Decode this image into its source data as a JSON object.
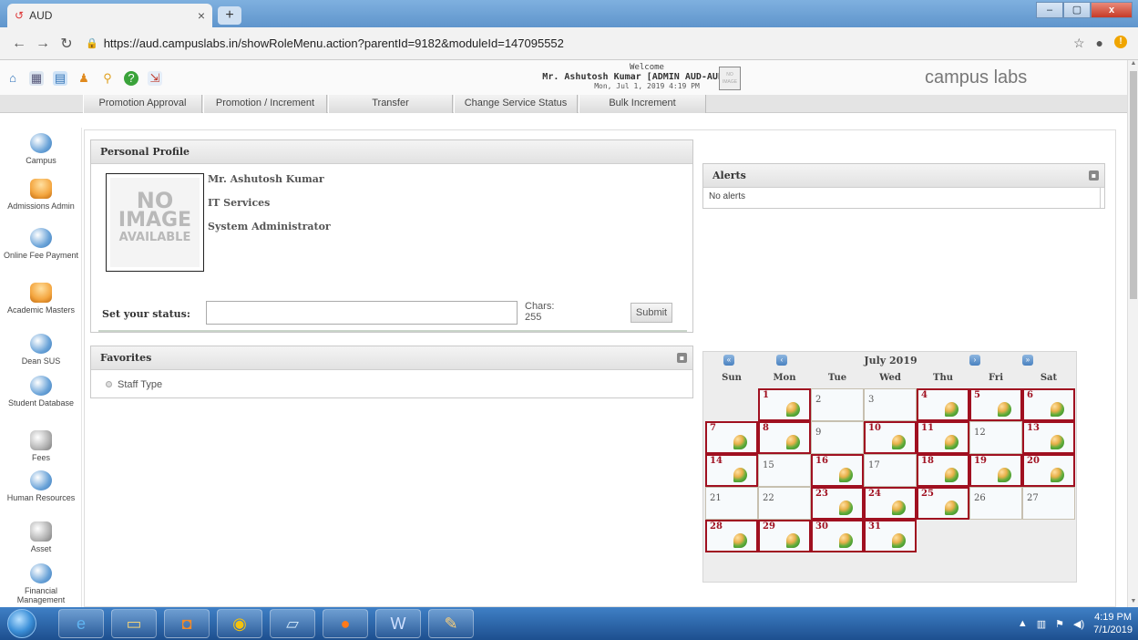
{
  "browser": {
    "tab_title": "AUD",
    "tab_close": "×",
    "new_tab": "+",
    "url": "https://aud.campuslabs.in/showRoleMenu.action?parentId=9182&moduleId=147095552",
    "window_buttons": {
      "minimize": "–",
      "maximize": "▢",
      "close": "x"
    }
  },
  "header": {
    "welcome": "Welcome",
    "user": "Mr. Ashutosh Kumar [ADMIN AUD-AUD]",
    "datetime": "Mon, Jul 1, 2019 4:19 PM",
    "brand": "campus labs",
    "toolbar_icons": [
      "home-icon",
      "calendar-icon",
      "user-docs-icon",
      "users-icon",
      "search-users-icon",
      "help-icon",
      "logout-icon"
    ]
  },
  "menu": {
    "items": [
      "Promotion Approval",
      "Promotion / Increment",
      "Transfer",
      "Change Service Status",
      "Bulk Increment"
    ]
  },
  "sidebar": {
    "items": [
      {
        "label": "Campus",
        "icon": "globe-icon"
      },
      {
        "label": "Admissions Admin",
        "icon": "admissions-icon"
      },
      {
        "label": "Online Fee Payment",
        "icon": "fee-icon"
      },
      {
        "label": "Academic Masters",
        "icon": "academic-icon"
      },
      {
        "label": "Dean SUS",
        "icon": "monitor-icon"
      },
      {
        "label": "Student Database",
        "icon": "database-icon"
      },
      {
        "label": "Fees",
        "icon": "money-icon"
      },
      {
        "label": "Human Resources",
        "icon": "hr-icon"
      },
      {
        "label": "Asset",
        "icon": "asset-icon"
      },
      {
        "label": "Financial Management",
        "icon": "finance-icon"
      }
    ]
  },
  "profile": {
    "title": "Personal Profile",
    "name": "Mr. Ashutosh Kumar",
    "department": "IT Services",
    "role": "System Administrator",
    "photo_text": {
      "line1": "NO",
      "line2": "IMAGE",
      "line3": "AVAILABLE"
    },
    "status_label": "Set your status:",
    "status_value": "",
    "chars_label": "Chars:",
    "chars_value": "255",
    "submit_label": "Submit"
  },
  "favorites": {
    "title": "Favorites",
    "items": [
      "Staff Type"
    ]
  },
  "alerts": {
    "title": "Alerts",
    "message": "No alerts"
  },
  "calendar": {
    "month_label": "July 2019",
    "weekdays": [
      "Sun",
      "Mon",
      "Tue",
      "Wed",
      "Thu",
      "Fri",
      "Sat"
    ],
    "first_weekday_index": 1,
    "days_in_month": 31,
    "event_days": [
      1,
      4,
      5,
      6,
      7,
      8,
      10,
      11,
      13,
      14,
      16,
      18,
      19,
      20,
      23,
      24,
      25,
      28,
      29,
      30,
      31
    ],
    "nav": {
      "prev_year": "«",
      "prev_month": "‹",
      "next_month": "›",
      "next_year": "»"
    }
  },
  "taskbar": {
    "time": "4:19 PM",
    "date": "7/1/2019",
    "apps": [
      "ie-icon",
      "explorer-icon",
      "outlook-icon",
      "chrome-icon",
      "notepad-icon",
      "firefox-icon",
      "word-icon",
      "paint-icon"
    ]
  },
  "colors": {
    "event_border": "#a01020",
    "menu_bg": "#e4e4e4",
    "taskbar": "#1d4f8f"
  }
}
